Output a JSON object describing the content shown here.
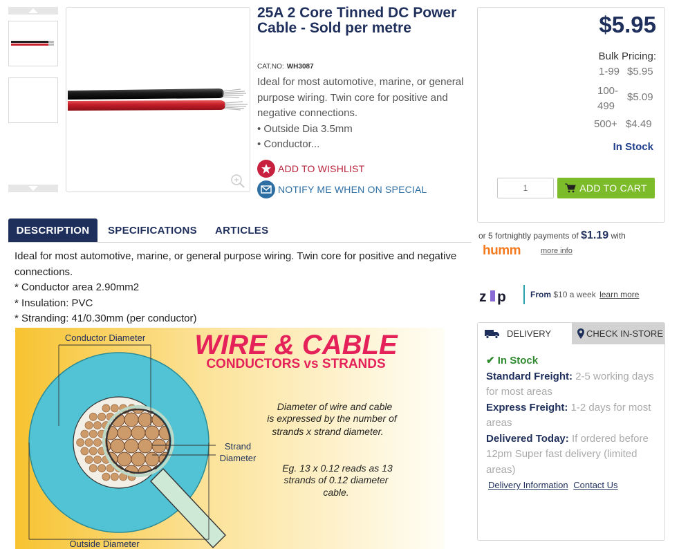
{
  "product": {
    "title": "25A 2 Core Tinned DC Power Cable - Sold per metre",
    "catno_label": "CAT.NO:",
    "catno": "WH3087",
    "short_desc_lines": [
      "Ideal for most automotive, marine, or general purpose wiring. Twin core for positive and negative connections.",
      "• Outside Dia 3.5mm",
      "• Conductor..."
    ],
    "wishlist_label": "ADD TO WISHLIST",
    "notify_label": "NOTIFY ME WHEN ON SPECIAL"
  },
  "pricing": {
    "price": "$5.95",
    "bulk_title": "Bulk Pricing:",
    "bulk": [
      {
        "qty": "1-99",
        "price": "$5.95"
      },
      {
        "qty": "100-499",
        "price": "$5.09"
      },
      {
        "qty": "500+",
        "price": "$4.49"
      }
    ],
    "stock": "In Stock",
    "qty_value": "1",
    "add_to_cart": "ADD TO CART"
  },
  "humm": {
    "prefix": "or 5 fortnightly payments of",
    "amount": "$1.19",
    "suffix": "with",
    "logo": "humm",
    "more": "more info"
  },
  "zip": {
    "logo": "zip",
    "from": "From",
    "amount": "$10 a week",
    "learn": "learn more"
  },
  "delivery": {
    "tab_delivery": "DELIVERY",
    "tab_checkin": "CHECK IN-STORE",
    "in_stock": "✔ In Stock",
    "standard_label": "Standard Freight:",
    "standard_text": "2-5 working days for most areas",
    "express_label": "Express Freight:",
    "express_text": "1-2 days for most areas",
    "today_label": "Delivered Today:",
    "today_text": "If ordered before 12pm Super fast delivery (limited areas)",
    "link_info": "Delivery Information",
    "link_contact": "Contact Us"
  },
  "tabs": {
    "description": "DESCRIPTION",
    "specifications": "SPECIFICATIONS",
    "articles": "ARTICLES"
  },
  "description": {
    "lines": [
      "Ideal for most automotive, marine, or general purpose wiring. Twin core for positive and negative connections.",
      "* Conductor area 2.90mm2",
      "* Insulation: PVC",
      "* Stranding: 41/0.30mm (per conductor)"
    ]
  },
  "diagram": {
    "title1": "WIRE & CABLE",
    "title2": "CONDUCTORS vs STRANDS",
    "conductor_diameter": "Conductor Diameter",
    "strand_diameter_1": "Strand",
    "strand_diameter_2": "Diameter",
    "outside_diameter": "Outside Diameter",
    "note1_lines": [
      "Diameter of wire and cable",
      "is expressed by the number of",
      "strands x strand diameter."
    ],
    "note2_lines": [
      "Eg. 13 x 0.12 reads as 13",
      "strands of 0.12 diameter",
      "cable."
    ]
  },
  "colors": {
    "navy": "#1f2f5c",
    "green": "#7cbb29",
    "wish_red": "#c8203f",
    "notify_blue": "#2d6ea3",
    "humm_orange": "#f47a20"
  }
}
